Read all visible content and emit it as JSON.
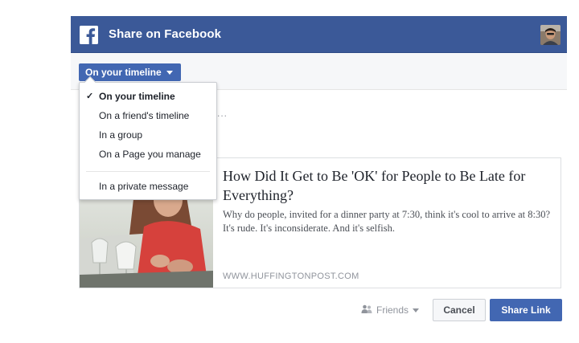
{
  "header": {
    "title": "Share on Facebook",
    "logo_icon": "facebook-f-icon",
    "avatar_icon": "user-avatar",
    "color": "#3b5998"
  },
  "toolbar": {
    "target_label": "On your timeline",
    "target_icon": "chevron-down-icon"
  },
  "composer": {
    "placeholder_hint": "..."
  },
  "dropdown": {
    "items": [
      {
        "label": "On your timeline",
        "selected": true
      },
      {
        "label": "On a friend's timeline",
        "selected": false
      },
      {
        "label": "In a group",
        "selected": false
      },
      {
        "label": "On a Page you manage",
        "selected": false
      },
      {
        "label": "In a private message",
        "selected": false
      }
    ],
    "check_glyph": "✓"
  },
  "preview": {
    "title": "How Did It Get to Be 'OK' for People to Be Late for Everything?",
    "description": "Why do people, invited for a dinner party at 7:30, think it's cool to arrive at 8:30? It's rude. It's inconsiderate. And it's selfish.",
    "domain": "WWW.HUFFINGTONPOST.COM"
  },
  "footer": {
    "audience_label": "Friends",
    "audience_icon": "friends-icon",
    "cancel_label": "Cancel",
    "share_label": "Share Link"
  },
  "colors": {
    "brand": "#3b5998",
    "button": "#4267b2"
  }
}
